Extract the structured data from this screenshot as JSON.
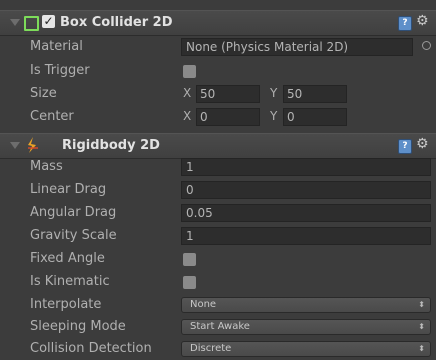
{
  "box_collider": {
    "title": "Box Collider 2D",
    "enabled_check": "✓",
    "material": {
      "label": "Material",
      "value": "None (Physics Material 2D)"
    },
    "is_trigger": {
      "label": "Is Trigger"
    },
    "size": {
      "label": "Size",
      "x_label": "X",
      "x": "50",
      "y_label": "Y",
      "y": "50"
    },
    "center": {
      "label": "Center",
      "x_label": "X",
      "x": "0",
      "y_label": "Y",
      "y": "0"
    }
  },
  "rigidbody": {
    "title": "Rigidbody 2D",
    "mass": {
      "label": "Mass",
      "value": "1"
    },
    "linear_drag": {
      "label": "Linear Drag",
      "value": "0"
    },
    "angular_drag": {
      "label": "Angular Drag",
      "value": "0.05"
    },
    "gravity_scale": {
      "label": "Gravity Scale",
      "value": "1"
    },
    "fixed_angle": {
      "label": "Fixed Angle"
    },
    "is_kinematic": {
      "label": "Is Kinematic"
    },
    "interpolate": {
      "label": "Interpolate",
      "value": "None"
    },
    "sleeping_mode": {
      "label": "Sleeping Mode",
      "value": "Start Awake"
    },
    "collision_detection": {
      "label": "Collision Detection",
      "value": "Discrete"
    }
  },
  "icons": {
    "help": "?",
    "gear": "⚙",
    "dropdown_arrow": "⬍"
  },
  "colors": {
    "background": "#3c3c3c",
    "field": "#2d2d2d",
    "collider_icon": "#7ddc5a",
    "rigidbody_icon": "#e7a227"
  }
}
